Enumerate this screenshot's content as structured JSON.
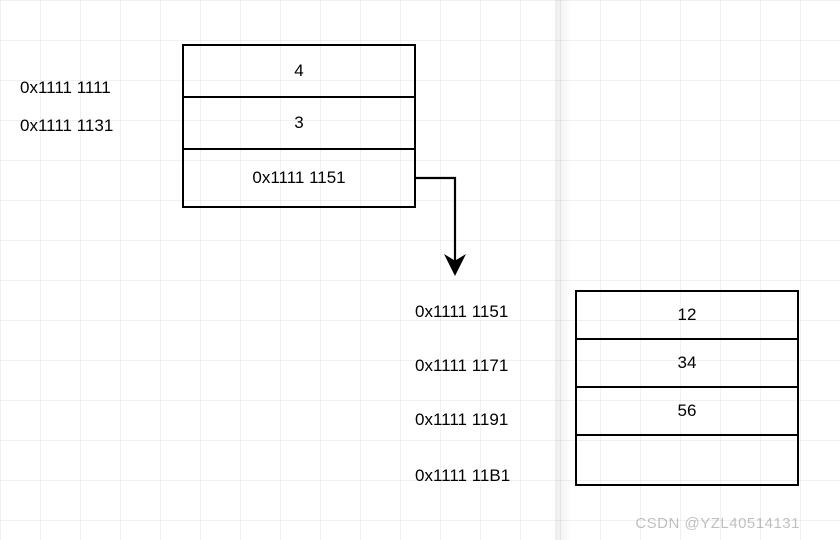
{
  "addresses": {
    "left_top": "0x1111 1111",
    "left_bottom": "0x1111 1131",
    "r0": "0x1111 1151",
    "r1": "0x1111 1171",
    "r2": "0x1111 1191",
    "r3": "0x1111 11B1"
  },
  "block_a": {
    "cell0": "4",
    "cell1": "3",
    "cell2": "0x1111 1151"
  },
  "block_b": {
    "cell0": "12",
    "cell1": "34",
    "cell2": "56",
    "cell3": ""
  },
  "watermark": "CSDN @YZL40514131"
}
